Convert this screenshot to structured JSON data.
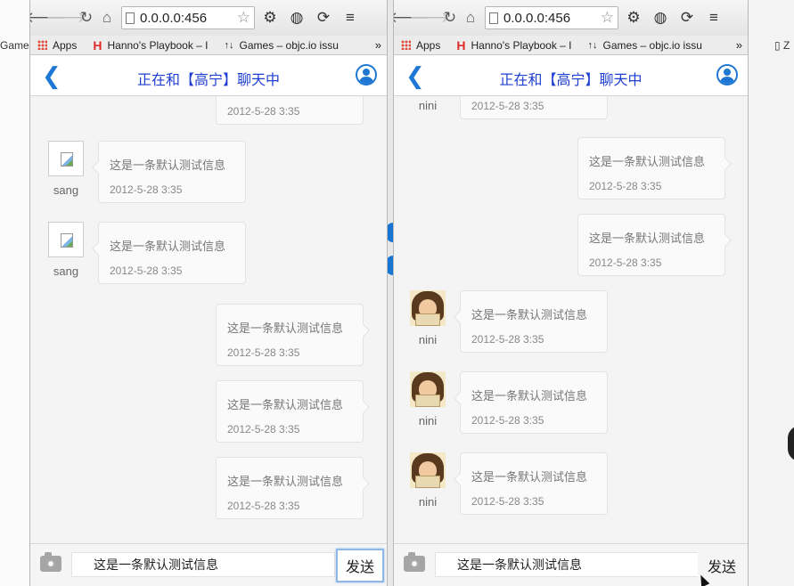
{
  "browser": {
    "url": "0.0.0.0:456",
    "bookmarks": [
      {
        "icon": "apps-grid-icon",
        "label": "Apps"
      },
      {
        "icon": "h-logo-icon",
        "label": "Hanno's Playbook – I"
      },
      {
        "icon": "sort-arrows-icon",
        "label": "Games – objc.io issu"
      }
    ],
    "more": "»",
    "ghost_left": "Game",
    "ghost_right": "Z"
  },
  "chat": {
    "title": "正在和【高宁】聊天中",
    "input_value": "这是一条默认测试信息",
    "send_label": "发送"
  },
  "colors": {
    "accent": "#1e77d2",
    "title": "#1e3fd0"
  },
  "window1": {
    "messages": [
      {
        "side": "right",
        "text": "",
        "time": "2012-5-28 3:35"
      },
      {
        "side": "left",
        "user": "sang",
        "text": "这是一条默认测试信息",
        "time": "2012-5-28 3:35"
      },
      {
        "side": "left",
        "user": "sang",
        "text": "这是一条默认测试信息",
        "time": "2012-5-28 3:35"
      },
      {
        "side": "right",
        "text": "这是一条默认测试信息",
        "time": "2012-5-28 3:35"
      },
      {
        "side": "right",
        "text": "这是一条默认测试信息",
        "time": "2012-5-28 3:35"
      },
      {
        "side": "right",
        "text": "这是一条默认测试信息",
        "time": "2012-5-28 3:35"
      }
    ]
  },
  "window2": {
    "messages": [
      {
        "side": "left",
        "user": "nini",
        "text": "",
        "time": "2012-5-28 3:35"
      },
      {
        "side": "right",
        "text": "这是一条默认测试信息",
        "time": "2012-5-28 3:35"
      },
      {
        "side": "right",
        "text": "这是一条默认测试信息",
        "time": "2012-5-28 3:35"
      },
      {
        "side": "left",
        "user": "nini",
        "text": "这是一条默认测试信息",
        "time": "2012-5-28 3:35"
      },
      {
        "side": "left",
        "user": "nini",
        "text": "这是一条默认测试信息",
        "time": "2012-5-28 3:35"
      },
      {
        "side": "left",
        "user": "nini",
        "text": "这是一条默认测试信息",
        "time": "2012-5-28 3:35"
      }
    ]
  }
}
